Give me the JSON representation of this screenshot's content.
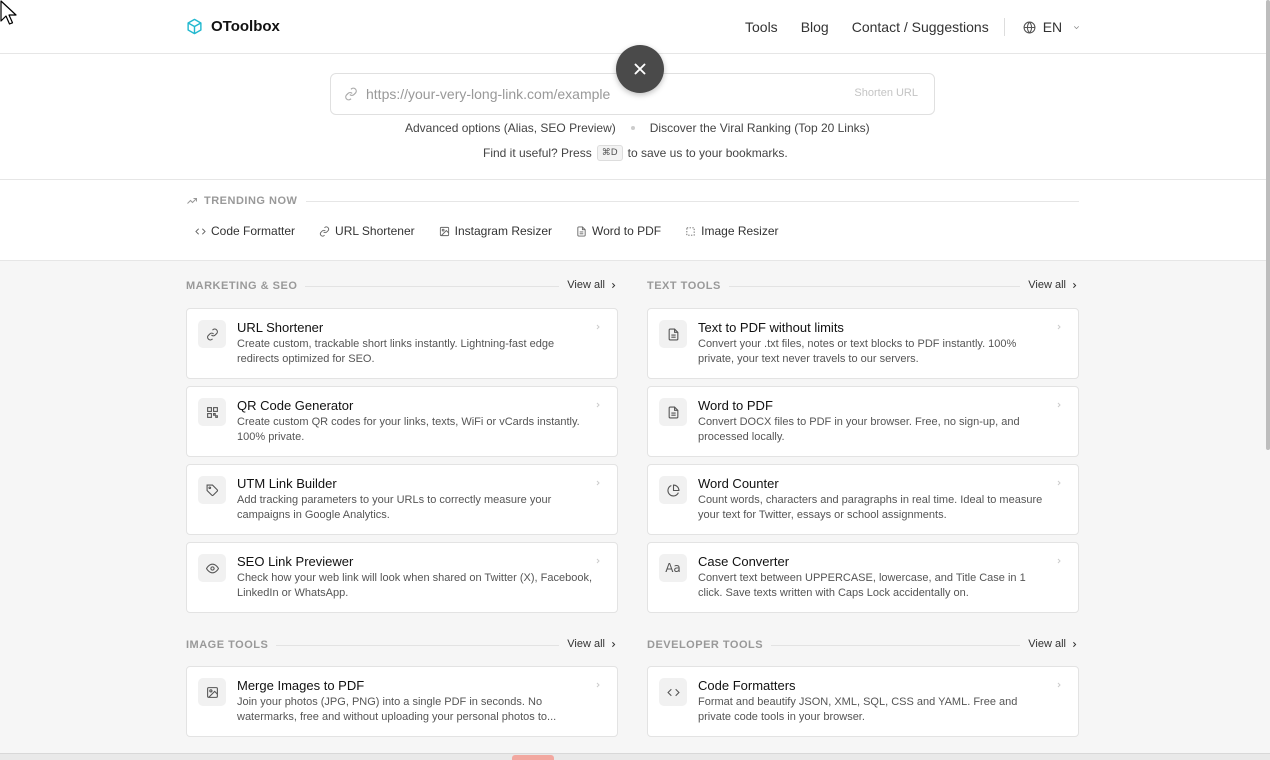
{
  "brand": {
    "name": "OToolbox",
    "accent": "#22b8cf"
  },
  "nav": {
    "links": [
      "Tools",
      "Blog",
      "Contact / Suggestions"
    ],
    "language": "EN"
  },
  "hero": {
    "input_placeholder": "https://your-very-long-link.com/example",
    "shorten_label": "Shorten URL",
    "advanced_link": "Advanced options (Alias, SEO Preview)",
    "ranking_link": "Discover the Viral Ranking (Top 20 Links)",
    "bookmark_prefix": "Find it useful? Press",
    "bookmark_key": "⌘D",
    "bookmark_suffix": "to save us to your bookmarks."
  },
  "trending": {
    "title": "TRENDING NOW",
    "items": [
      {
        "label": "Code Formatter",
        "icon": "code-icon"
      },
      {
        "label": "URL Shortener",
        "icon": "link-icon"
      },
      {
        "label": "Instagram Resizer",
        "icon": "image-icon"
      },
      {
        "label": "Word to PDF",
        "icon": "file-icon"
      },
      {
        "label": "Image Resizer",
        "icon": "crop-icon"
      }
    ]
  },
  "sections": {
    "marketing": {
      "title": "MARKETING & SEO",
      "view_all": "View all",
      "cards": [
        {
          "title": "URL Shortener",
          "desc": "Create custom, trackable short links instantly. Lightning-fast edge redirects optimized for SEO.",
          "icon": "link-icon"
        },
        {
          "title": "QR Code Generator",
          "desc": "Create custom QR codes for your links, texts, WiFi or vCards instantly. 100% private.",
          "icon": "qr-icon"
        },
        {
          "title": "UTM Link Builder",
          "desc": "Add tracking parameters to your URLs to correctly measure your campaigns in Google Analytics.",
          "icon": "tag-icon"
        },
        {
          "title": "SEO Link Previewer",
          "desc": "Check how your web link will look when shared on Twitter (X), Facebook, LinkedIn or WhatsApp.",
          "icon": "eye-icon"
        }
      ]
    },
    "text": {
      "title": "TEXT TOOLS",
      "view_all": "View all",
      "cards": [
        {
          "title": "Text to PDF without limits",
          "desc": "Convert your .txt files, notes or text blocks to PDF instantly. 100% private, your text never travels to our servers.",
          "icon": "file-text-icon"
        },
        {
          "title": "Word to PDF",
          "desc": "Convert DOCX files to PDF in your browser. Free, no sign-up, and processed locally.",
          "icon": "file-text-icon"
        },
        {
          "title": "Word Counter",
          "desc": "Count words, characters and paragraphs in real time. Ideal to measure your text for Twitter, essays or school assignments.",
          "icon": "pie-chart-icon"
        },
        {
          "title": "Case Converter",
          "desc": "Convert text between UPPERCASE, lowercase, and Title Case in 1 click. Save texts written with Caps Lock accidentally on.",
          "icon": "case-icon"
        }
      ]
    },
    "image": {
      "title": "IMAGE TOOLS",
      "view_all": "View all",
      "cards": [
        {
          "title": "Merge Images to PDF",
          "desc": "Join your photos (JPG, PNG) into a single PDF in seconds. No watermarks, free and without uploading your personal photos to...",
          "icon": "image-icon"
        }
      ]
    },
    "developer": {
      "title": "DEVELOPER TOOLS",
      "view_all": "View all",
      "cards": [
        {
          "title": "Code Formatters",
          "desc": "Format and beautify JSON, XML, SQL, CSS and YAML. Free and private code tools in your browser.",
          "icon": "code-icon"
        }
      ]
    }
  }
}
